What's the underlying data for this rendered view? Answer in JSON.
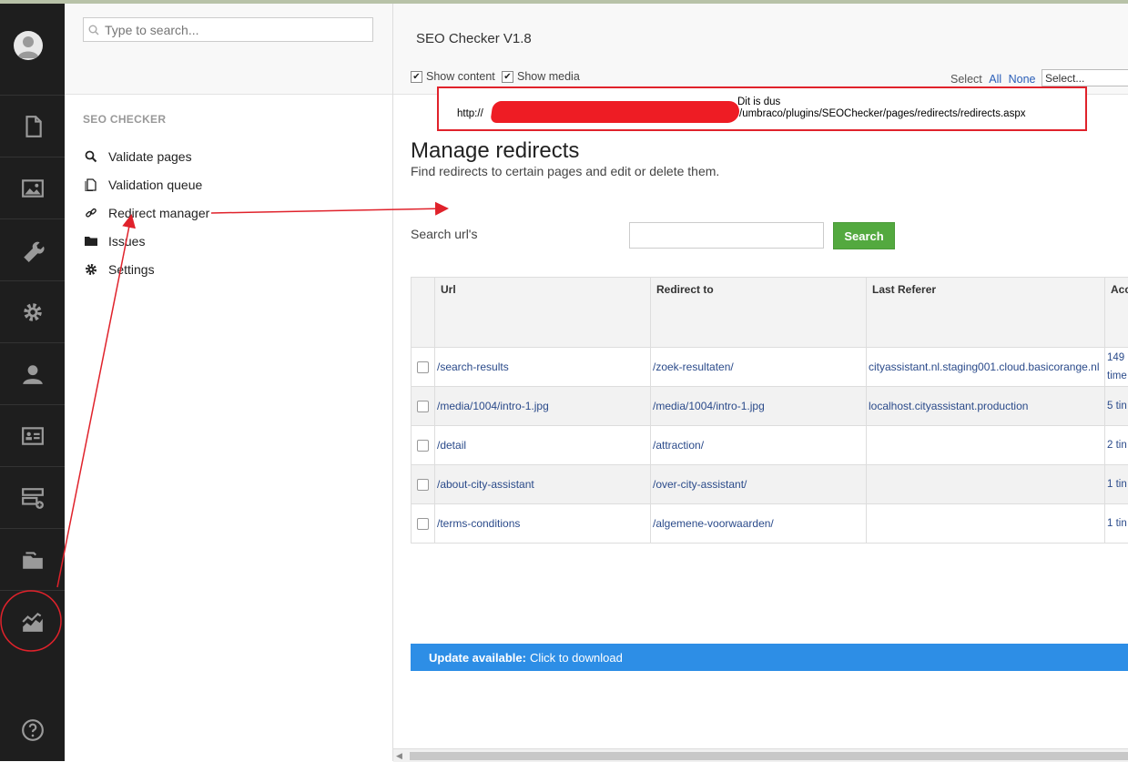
{
  "tree": {
    "search_placeholder": "Type to search...",
    "section_title": "SEO CHECKER",
    "items": [
      {
        "label": "Validate pages",
        "icon": "search-icon"
      },
      {
        "label": "Validation queue",
        "icon": "document-icon"
      },
      {
        "label": "Redirect manager",
        "icon": "link-icon"
      },
      {
        "label": "Issues",
        "icon": "folder-icon"
      },
      {
        "label": "Settings",
        "icon": "gear-icon"
      }
    ]
  },
  "rail": {
    "items": [
      "content-icon",
      "media-icon",
      "developer-wrench-icon",
      "settings-gear-icon",
      "users-icon",
      "members-card-icon",
      "forms-icon",
      "packages-icon",
      "seo-analytics-icon",
      "help-icon"
    ]
  },
  "header": {
    "app_title": "SEO Checker V1.8",
    "show_content": "Show content",
    "show_media": "Show media",
    "select_label": "Select",
    "all": "All",
    "none": "None",
    "select_value": "Select..."
  },
  "annotation": {
    "note": "Dit is dus",
    "url_prefix": "http://",
    "url_suffix": "/umbraco/plugins/SEOChecker/pages/redirects/redirects.aspx"
  },
  "main": {
    "title": "Manage redirects",
    "subtitle": "Find redirects to certain pages and edit or delete them.",
    "search_label": "Search url's",
    "search_button": "Search"
  },
  "table": {
    "headers": [
      "Url",
      "Redirect to",
      "Last Referer",
      "Acc"
    ],
    "rows": [
      {
        "url": "/search-results",
        "redirect": "/zoek-resultaten/",
        "referer": "cityassistant.nl.staging001.cloud.basicorange.nl",
        "accessed": "149 time"
      },
      {
        "url": "/media/1004/intro-1.jpg",
        "redirect": "/media/1004/intro-1.jpg",
        "referer": "localhost.cityassistant.production",
        "accessed": "5 tin"
      },
      {
        "url": "/detail",
        "redirect": "/attraction/",
        "referer": "",
        "accessed": "2 tin"
      },
      {
        "url": "/about-city-assistant",
        "redirect": "/over-city-assistant/",
        "referer": "",
        "accessed": "1 tin"
      },
      {
        "url": "/terms-conditions",
        "redirect": "/algemene-voorwaarden/",
        "referer": "",
        "accessed": "1 tin"
      }
    ]
  },
  "update": {
    "bold": "Update available:",
    "text": "Click to download"
  },
  "colors": {
    "rail_bg": "#1e1e1e",
    "search_button": "#53a93f",
    "update_bar": "#2d8ee6",
    "annotation_red": "#e0222b"
  }
}
